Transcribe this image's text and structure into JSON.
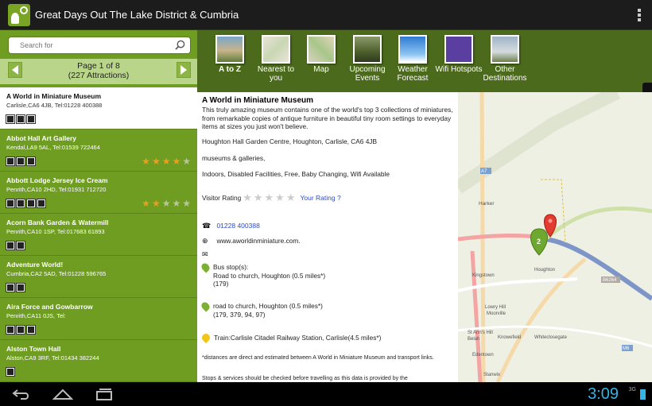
{
  "app": {
    "title": "Great Days Out The Lake District & Cumbria"
  },
  "search": {
    "placeholder": "Search for"
  },
  "pager": {
    "page": "Page 1 of 8",
    "count": "(227 Attractions)"
  },
  "attractions": [
    {
      "name": "A World in Miniature Museum",
      "address": "Carlisle,CA6 4JB, Tel:01228 400388",
      "rating": 0
    },
    {
      "name": "Abbot Hall Art Gallery",
      "address": "Kendal,LA9 5AL, Tel:01539 722464",
      "rating": 4
    },
    {
      "name": "Abbott Lodge Jersey Ice Cream",
      "address": "Penrith,CA10 2HD, Tel:01931 712720",
      "rating": 2
    },
    {
      "name": "Acorn Bank Garden & Watermill",
      "address": "Penrith,CA10 1SP, Tel:017683 61893",
      "rating": 0
    },
    {
      "name": "Adventure World!",
      "address": "Cumbria,CA2 5AD, Tel:01228 596765",
      "rating": 0
    },
    {
      "name": "Aira Force and Gowbarrow",
      "address": "Penrith,CA11 0JS, Tel:",
      "rating": 0
    },
    {
      "name": "Alston Town Hall",
      "address": "Alston,CA9 3RF, Tel:01434 382244",
      "rating": 0
    }
  ],
  "toolbar": [
    {
      "label": "A to Z",
      "icon": "atoz-photo-icon"
    },
    {
      "label": "Nearest to you",
      "icon": "nearest-map-icon"
    },
    {
      "label": "Map",
      "icon": "map-icon"
    },
    {
      "label": "Upcoming Events",
      "icon": "events-icon"
    },
    {
      "label": "Weather Forecast",
      "icon": "weather-icon"
    },
    {
      "label": "Wifi Hotspots",
      "icon": "wifi-icon"
    },
    {
      "label": "Other Destinations",
      "icon": "signpost-icon"
    }
  ],
  "detail": {
    "title": "A World in Miniature Museum",
    "description": "This truly amazing museum contains one of the world's top 3 collections of miniatures, from remarkable copies of antique furniture in beautiful tiny room settings to everyday items at sizes you just won't believe.",
    "address": "Houghton Hall Garden Centre, Houghton, Carlisle, CA6 4JB",
    "category": "museums & galleries,",
    "facilities": "Indoors, Disabled Facilities, Free, Baby Changing, Wifi Available",
    "rating_label": "Visitor Rating",
    "your_rating": "Your Rating ?",
    "phone": "01228 400388",
    "website": "www.aworldinminiature.com.",
    "bus_title": "Bus stop(s):",
    "bus_stop_1": "Road to church, Houghton (0.5 miles*)",
    "bus_routes_1": "(179)",
    "bus_stop_2": "road to church, Houghton (0.5 miles*)",
    "bus_routes_2": "(179, 379, 94, 97)",
    "train": "Train:Carlisle Citadel Railway Station, Carlisle(4.5 miles*)",
    "footnote": "*distances are direct and estimated between A World in Miniature Museum and transport links.",
    "footnote2": "Stops & services should be checked before travelling as this data is provided by the"
  },
  "map": {
    "labels": {
      "harker": "Harker",
      "houghton": "Houghton",
      "kingstown": "Kingstown",
      "lowry_hill": "Lowry Hill",
      "moorville": "Moorville",
      "knowefield": "Knowefield",
      "whiteclosegate": "Whiteclosegate",
      "st_anns": "St Ann's Hill",
      "belah": "Belah",
      "edentown": "Edentown",
      "stanwix": "Stanwix",
      "a7": "A7",
      "b6264": "B6264",
      "m6": "M6",
      "cluster": "2"
    }
  },
  "status": {
    "time": "3:09",
    "signal": "3G"
  }
}
